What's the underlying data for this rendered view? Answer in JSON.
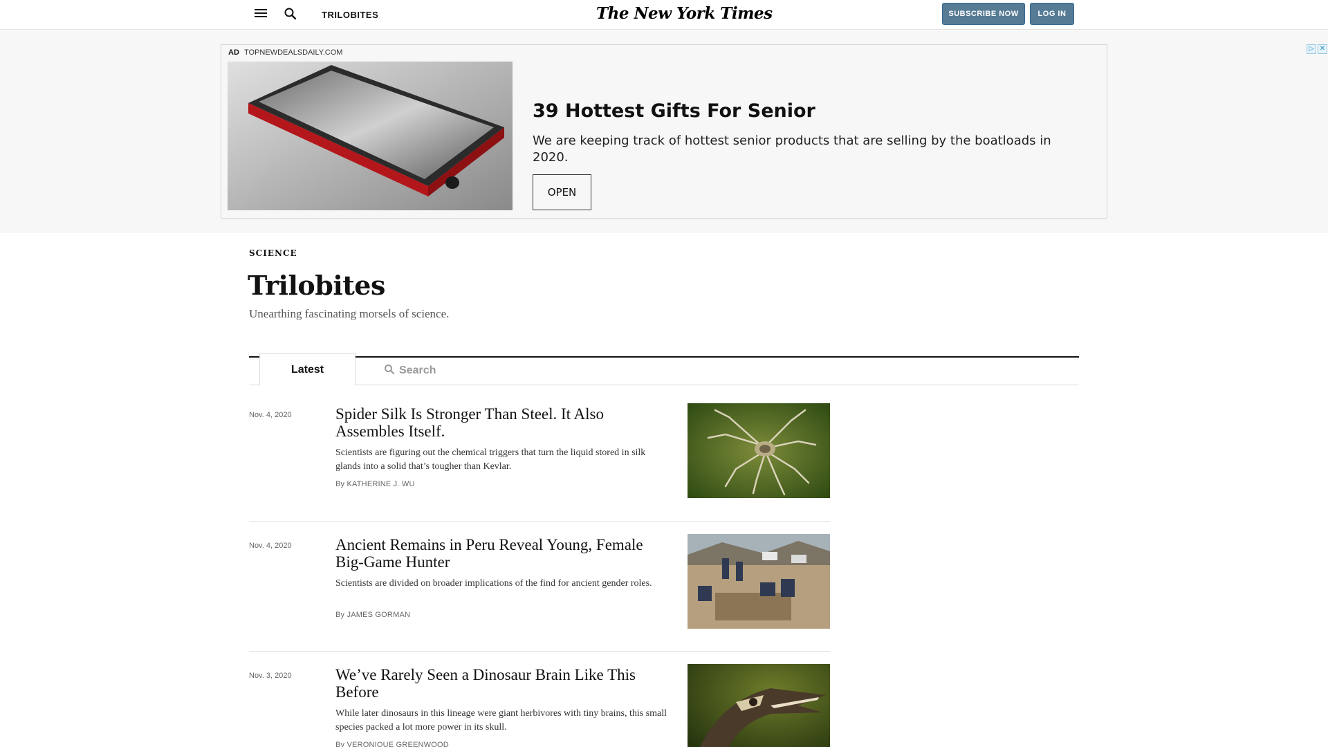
{
  "header": {
    "section_name": "TRILOBITES",
    "logo": "The New York Times",
    "subscribe_label": "SUBSCRIBE NOW",
    "login_label": "LOG IN"
  },
  "ad": {
    "label": "AD",
    "domain": "TOPNEWDEALSDAILY.COM",
    "headline": "39 Hottest Gifts For Senior",
    "body": "We are keeping track of hottest senior products that are selling by the boatloads in 2020.",
    "cta_label": "OPEN"
  },
  "section": {
    "kicker": "SCIENCE",
    "title": "Trilobites",
    "subtitle": "Unearthing fascinating morsels of science."
  },
  "tabs": {
    "latest_label": "Latest",
    "search_placeholder": "Search"
  },
  "articles": [
    {
      "date": "Nov. 4, 2020",
      "title": "Spider Silk Is Stronger Than Steel. It Also Assembles Itself.",
      "summary": "Scientists are figuring out the chemical triggers that turn the liquid stored in silk glands into a solid that’s tougher than Kevlar.",
      "byline": "By KATHERINE J. WU",
      "thumb": "spider-photo"
    },
    {
      "date": "Nov. 4, 2020",
      "title": "Ancient Remains in Peru Reveal Young, Female Big-Game Hunter",
      "summary": "Scientists are divided on broader implications of the find for ancient gender roles.",
      "byline": "By JAMES GORMAN",
      "thumb": "excavation-photo"
    },
    {
      "date": "Nov. 3, 2020",
      "title": "We’ve Rarely Seen a Dinosaur Brain Like This Before",
      "summary": "While later dinosaurs in this lineage were giant herbivores with tiny brains, this small species packed a lot more power in its skull.",
      "byline": "By VERONIQUE GREENWOOD",
      "thumb": "dinosaur-skull-photo"
    }
  ],
  "colors": {
    "button_blue": "#567b95",
    "ad_background": "#f7f7f7",
    "divider": "#dcdcdc"
  }
}
